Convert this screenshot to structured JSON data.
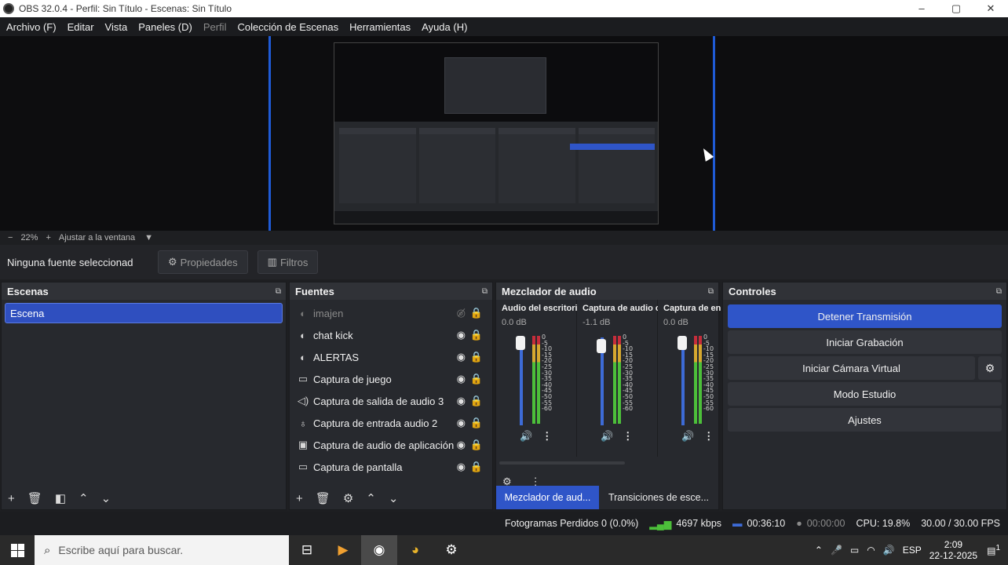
{
  "window": {
    "title": "OBS 32.0.4 - Perfil: Sin Título - Escenas: Sin Título",
    "controls": [
      "–",
      "▢",
      "✕"
    ]
  },
  "menu": [
    {
      "label": "Archivo (F)",
      "enabled": true
    },
    {
      "label": "Editar",
      "enabled": true
    },
    {
      "label": "Vista",
      "enabled": true
    },
    {
      "label": "Paneles (D)",
      "enabled": true
    },
    {
      "label": "Perfil",
      "enabled": false
    },
    {
      "label": "Colección de Escenas",
      "enabled": true
    },
    {
      "label": "Herramientas",
      "enabled": true
    },
    {
      "label": "Ayuda (H)",
      "enabled": true
    }
  ],
  "zoom": {
    "minus": "−",
    "value": "22%",
    "plus": "+",
    "fit": "Ajustar a la ventana"
  },
  "source_bar": {
    "status": "Ninguna fuente seleccionad",
    "properties": "Propiedades",
    "filters": "Filtros"
  },
  "scenes": {
    "title": "Escenas",
    "items": [
      "Escena"
    ]
  },
  "sources": {
    "title": "Fuentes",
    "items": [
      {
        "icon": "image-icon",
        "label": "imajen",
        "visible": false
      },
      {
        "icon": "browser-icon",
        "label": "chat kick",
        "visible": true
      },
      {
        "icon": "browser-icon",
        "label": "ALERTAS",
        "visible": true
      },
      {
        "icon": "gamepad-icon",
        "label": "Captura de juego",
        "visible": true
      },
      {
        "icon": "speaker-icon",
        "label": "Captura de salida de audio 3",
        "visible": true
      },
      {
        "icon": "microphone-icon",
        "label": "Captura de entrada audio 2",
        "visible": true
      },
      {
        "icon": "app-audio-icon",
        "label": "Captura de audio de aplicación",
        "visible": true
      },
      {
        "icon": "monitor-icon",
        "label": "Captura de pantalla",
        "visible": true
      }
    ]
  },
  "mixer": {
    "title": "Mezclador de audio",
    "channels": [
      {
        "name": "Audio del escritorio",
        "db": "0.0 dB",
        "level": 0.8
      },
      {
        "name": "Captura de audio c",
        "db": "-1.1 dB",
        "level": 0.8
      },
      {
        "name": "Captura de en",
        "db": "0.0 dB",
        "level": 0.8
      }
    ],
    "ticks": [
      "0",
      "-5",
      "-10",
      "-15",
      "-20",
      "-25",
      "-30",
      "-35",
      "-40",
      "-45",
      "-50",
      "-55",
      "-60"
    ],
    "tabs": [
      "Mezclador de aud...",
      "Transiciones de esce..."
    ]
  },
  "controls": {
    "title": "Controles",
    "stop_stream": "Detener Transmisión",
    "start_recording": "Iniciar Grabación",
    "start_virtual_cam": "Iniciar Cámara Virtual",
    "studio_mode": "Modo Estudio",
    "settings": "Ajustes"
  },
  "status": {
    "dropped_frames": "Fotogramas Perdidos 0 (0.0%)",
    "bitrate": "4697 kbps",
    "stream_time": "00:36:10",
    "rec_time": "00:00:00",
    "cpu": "CPU: 19.8%",
    "fps": "30.00 / 30.00 FPS"
  },
  "taskbar": {
    "search_placeholder": "Escribe aquí para buscar.",
    "lang": "ESP",
    "time": "2:09",
    "date": "22-12-2025",
    "notif": "1"
  },
  "colors": {
    "accent": "#2f55c8",
    "panel": "#27292e",
    "preview_border": "#1f5bd6"
  }
}
